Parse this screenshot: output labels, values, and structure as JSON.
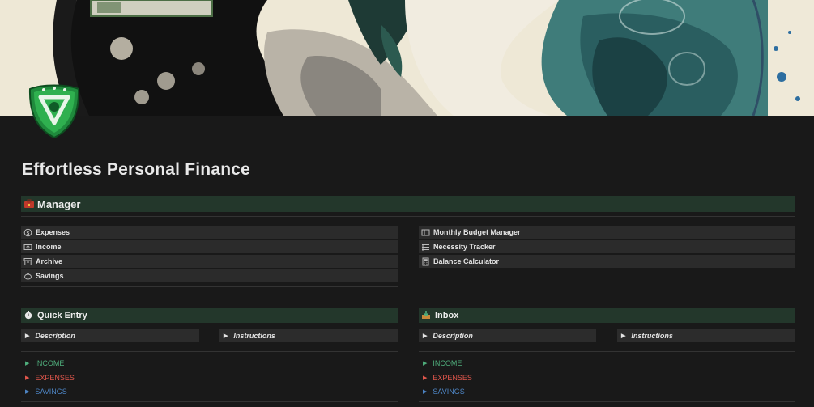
{
  "page": {
    "title": "Effortless Personal Finance"
  },
  "colors": {
    "section_bar": "#23372b",
    "income": "#4fae7c",
    "expenses": "#e2574c",
    "savings": "#4e86c6"
  },
  "manager": {
    "heading": "Manager",
    "heading_icon": "briefcase-icon",
    "left_links": [
      {
        "label": "Expenses",
        "icon": "refund-icon"
      },
      {
        "label": "Income",
        "icon": "cash-icon"
      },
      {
        "label": "Archive",
        "icon": "archive-icon"
      },
      {
        "label": "Savings",
        "icon": "piggy-bank-icon"
      }
    ],
    "right_links": [
      {
        "label": "Monthly Budget Manager",
        "icon": "card-icon"
      },
      {
        "label": "Necessity Tracker",
        "icon": "checklist-icon"
      },
      {
        "label": "Balance Calculator",
        "icon": "calculator-icon"
      }
    ]
  },
  "quick_entry": {
    "heading": "Quick Entry",
    "heading_icon": "stopwatch-icon",
    "toggles": [
      "Description",
      "Instructions"
    ],
    "categories": [
      "INCOME",
      "EXPENSES",
      "SAVINGS"
    ]
  },
  "inbox": {
    "heading": "Inbox",
    "heading_icon": "inbox-tray-icon",
    "toggles": [
      "Description",
      "Instructions"
    ],
    "categories": [
      "INCOME",
      "EXPENSES",
      "SAVINGS"
    ]
  }
}
